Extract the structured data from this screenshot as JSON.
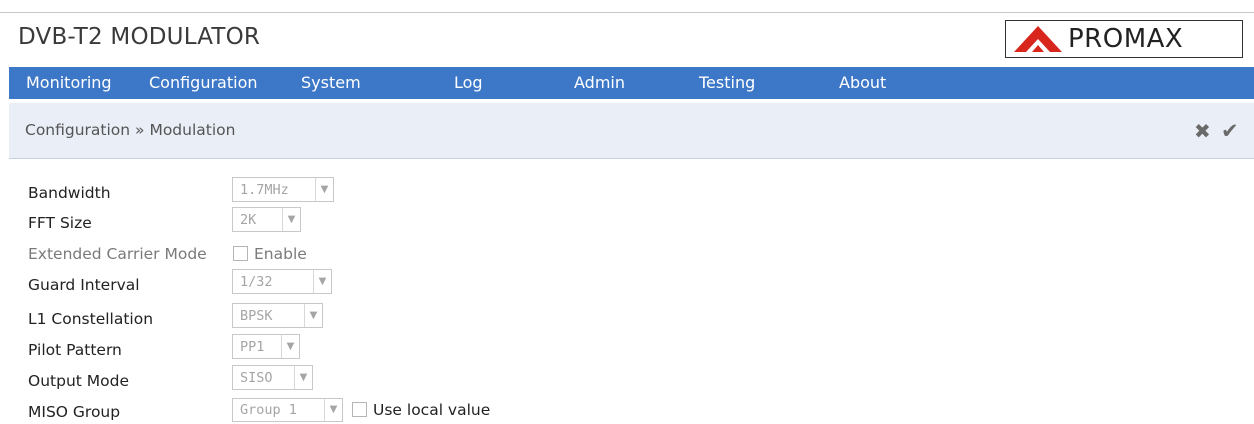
{
  "header": {
    "title": "DVB-T2 MODULATOR",
    "logo_text": "PROMAX",
    "logo_color": "#d9261c"
  },
  "nav": {
    "items": [
      "Monitoring",
      "Configuration",
      "System",
      "Log",
      "Admin",
      "Testing",
      "About"
    ],
    "bar_color": "#3d78c8"
  },
  "breadcrumb": {
    "text": "Configuration » Modulation"
  },
  "actions": {
    "cancel_icon": "close-icon",
    "confirm_icon": "check-icon"
  },
  "form": {
    "bandwidth": {
      "label": "Bandwidth",
      "value": "1.7MHz"
    },
    "fft_size": {
      "label": "FFT Size",
      "value": "2K"
    },
    "extended_carrier": {
      "label": "Extended Carrier Mode",
      "checkbox_label": "Enable",
      "checked": false
    },
    "guard_interval": {
      "label": "Guard Interval",
      "value": "1/32"
    },
    "l1_constellation": {
      "label": "L1 Constellation",
      "value": "BPSK"
    },
    "pilot_pattern": {
      "label": "Pilot Pattern",
      "value": "PP1"
    },
    "output_mode": {
      "label": "Output Mode",
      "value": "SISO"
    },
    "miso_group": {
      "label": "MISO Group",
      "value": "Group 1",
      "checkbox_label": "Use local value",
      "checked": false
    }
  }
}
